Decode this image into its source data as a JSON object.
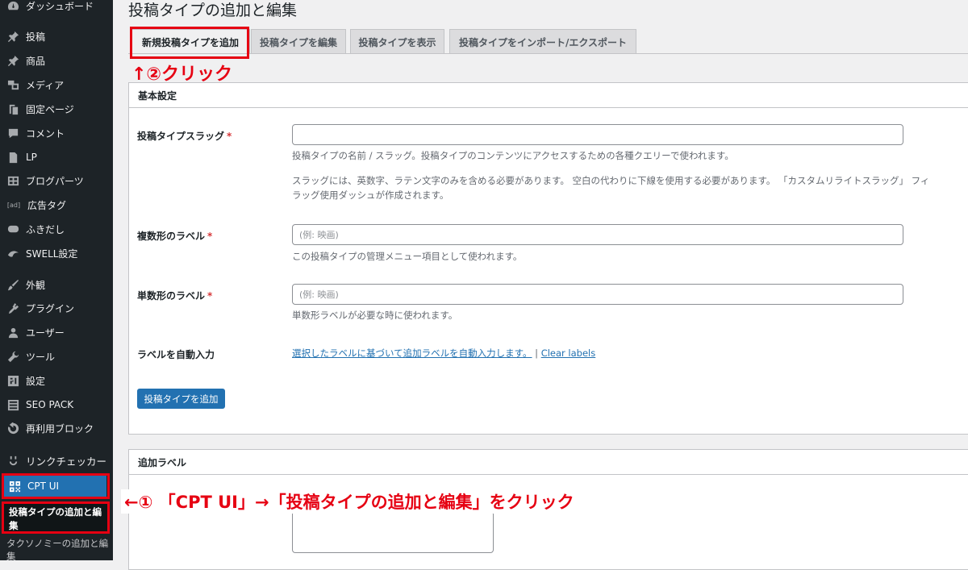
{
  "sidebar": {
    "items": [
      {
        "label": "ダッシュボード",
        "icon": "dashboard-icon"
      },
      {
        "label": "投稿",
        "icon": "pin-icon"
      },
      {
        "label": "商品",
        "icon": "pin-icon"
      },
      {
        "label": "メディア",
        "icon": "media-icon"
      },
      {
        "label": "固定ページ",
        "icon": "page-icon"
      },
      {
        "label": "コメント",
        "icon": "comment-icon"
      },
      {
        "label": "LP",
        "icon": "document-icon"
      },
      {
        "label": "ブログパーツ",
        "icon": "grid-icon"
      },
      {
        "label": "広告タグ",
        "icon": "ad-icon"
      },
      {
        "label": "ふきだし",
        "icon": "speech-bubble-icon"
      },
      {
        "label": "SWELL設定",
        "icon": "swell-icon"
      },
      {
        "label": "外観",
        "icon": "brush-icon"
      },
      {
        "label": "プラグイン",
        "icon": "plugin-icon"
      },
      {
        "label": "ユーザー",
        "icon": "user-icon"
      },
      {
        "label": "ツール",
        "icon": "wrench-icon"
      },
      {
        "label": "設定",
        "icon": "settings-icon"
      },
      {
        "label": "SEO PACK",
        "icon": "list-icon"
      },
      {
        "label": "再利用ブロック",
        "icon": "reuse-icon"
      },
      {
        "label": "リンクチェッカー",
        "icon": "link-checker-icon"
      },
      {
        "label": "CPT UI",
        "icon": "cpt-ui-icon"
      }
    ],
    "submenu": {
      "current": "投稿タイプの追加と編集",
      "next": "タクソノミーの追加と編集"
    }
  },
  "page_title": "投稿タイプの追加と編集",
  "tabs": [
    "新規投稿タイプを追加",
    "投稿タイプを編集",
    "投稿タイプを表示",
    "投稿タイプをインポート/エクスポート"
  ],
  "annotations": {
    "step2": "↑②クリック",
    "step1": "←① 「CPT UI」→「投稿タイプの追加と編集」をクリック"
  },
  "basic_settings": {
    "heading": "基本設定",
    "slug": {
      "label": "投稿タイプスラッグ",
      "required": "*",
      "value": "",
      "desc1": "投稿タイプの名前 / スラッグ。投稿タイプのコンテンツにアクセスするための各種クエリーで使われます。",
      "desc2": "スラッグには、英数字、ラテン文字のみを含める必要があります。 空白の代わりに下線を使用する必要があります。 「カスタムリライトスラッグ」 フィ",
      "desc3": "ラッグ使用ダッシュが作成されます。"
    },
    "plural": {
      "label": "複数形のラベル",
      "required": "*",
      "placeholder": "(例: 映画)",
      "desc": "この投稿タイプの管理メニュー項目として使われます。"
    },
    "singular": {
      "label": "単数形のラベル",
      "required": "*",
      "placeholder": "(例: 映画)",
      "desc": "単数形ラベルが必要な時に使われます。"
    },
    "autofill": {
      "label": "ラベルを自動入力",
      "link": "選択したラベルに基づいて追加ラベルを自動入力します。",
      "separator": "|",
      "clear": "Clear labels"
    },
    "submit": "投稿タイプを追加"
  },
  "additional_labels": {
    "heading": "追加ラベル"
  },
  "colors": {
    "sidebar_bg": "#1d2327",
    "accent": "#2271b1",
    "annotation": "#e60012"
  }
}
